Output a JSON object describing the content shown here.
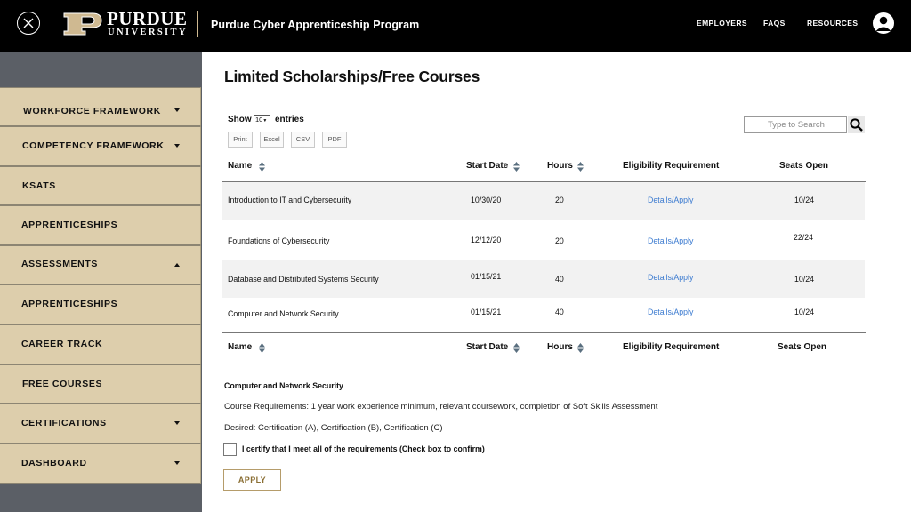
{
  "header": {
    "logo_word": "PURDUE",
    "logo_sub": "UNIVERSITY",
    "program_title": "Purdue Cyber Apprenticeship Program",
    "nav": [
      "EMPLOYERS",
      "FAQS",
      "RESOURCES"
    ],
    "icons": {
      "close": "close-circle-icon",
      "avatar": "user-avatar-icon"
    }
  },
  "sidebar": {
    "items": [
      {
        "label": "WORKFORCE FRAMEWORK",
        "caret": "down"
      },
      {
        "label": "COMPETENCY FRAMEWORK",
        "caret": "down"
      },
      {
        "label": "KSATS",
        "caret": ""
      },
      {
        "label": "APPRENTICESHIPS",
        "caret": ""
      },
      {
        "label": "ASSESSMENTS",
        "caret": "up"
      },
      {
        "label": "APPRENTICESHIPS",
        "caret": ""
      },
      {
        "label": "CAREER TRACK",
        "caret": ""
      },
      {
        "label": "FREE COURSES",
        "caret": ""
      },
      {
        "label": "CERTIFICATIONS",
        "caret": "down"
      },
      {
        "label": "DASHBOARD",
        "caret": "down"
      }
    ]
  },
  "main": {
    "title": "Limited Scholarships/Free Courses",
    "show_label": "Show",
    "entries_value": "10",
    "entries_label": "entries",
    "export_buttons": [
      "Print",
      "Excel",
      "CSV",
      "PDF"
    ],
    "search_placeholder": "Type to Search",
    "columns": [
      "Name",
      "Start Date",
      "Hours",
      "Eligibility Requirement",
      "Seats Open"
    ],
    "rows": [
      {
        "name": "Introduction to IT and Cybersecurity",
        "start": "10/30/20",
        "hours": "20",
        "link": "Details/Apply",
        "seats": "10/24"
      },
      {
        "name": "Foundations of Cybersecurity",
        "start": "12/12/20",
        "hours": "20",
        "link": "Details/Apply",
        "seats": "22/24"
      },
      {
        "name": "Database and Distributed Systems Security",
        "start": "01/15/21",
        "hours": "40",
        "link": "Details/Apply",
        "seats": "10/24"
      },
      {
        "name": "Computer and Network Security.",
        "start": "01/15/21",
        "hours": "40",
        "link": "Details/Apply",
        "seats": "10/24"
      }
    ],
    "detail": {
      "title": "Computer and Network Security",
      "requirements": "Course Requirements: 1 year work experience minimum, relevant coursework, completion of Soft Skills Assessment",
      "desired": "Desired:  Certification (A), Certification (B), Certification (C)",
      "certify_label": "I certify that I meet all of the requirements (Check box to confirm)",
      "apply_label": "APPLY"
    }
  },
  "colors": {
    "sidebar_item": "#ddceac",
    "sidebar_bg": "#5b5f66",
    "gold": "#cfb991",
    "link": "#3c7bd0",
    "header": "#000000"
  }
}
